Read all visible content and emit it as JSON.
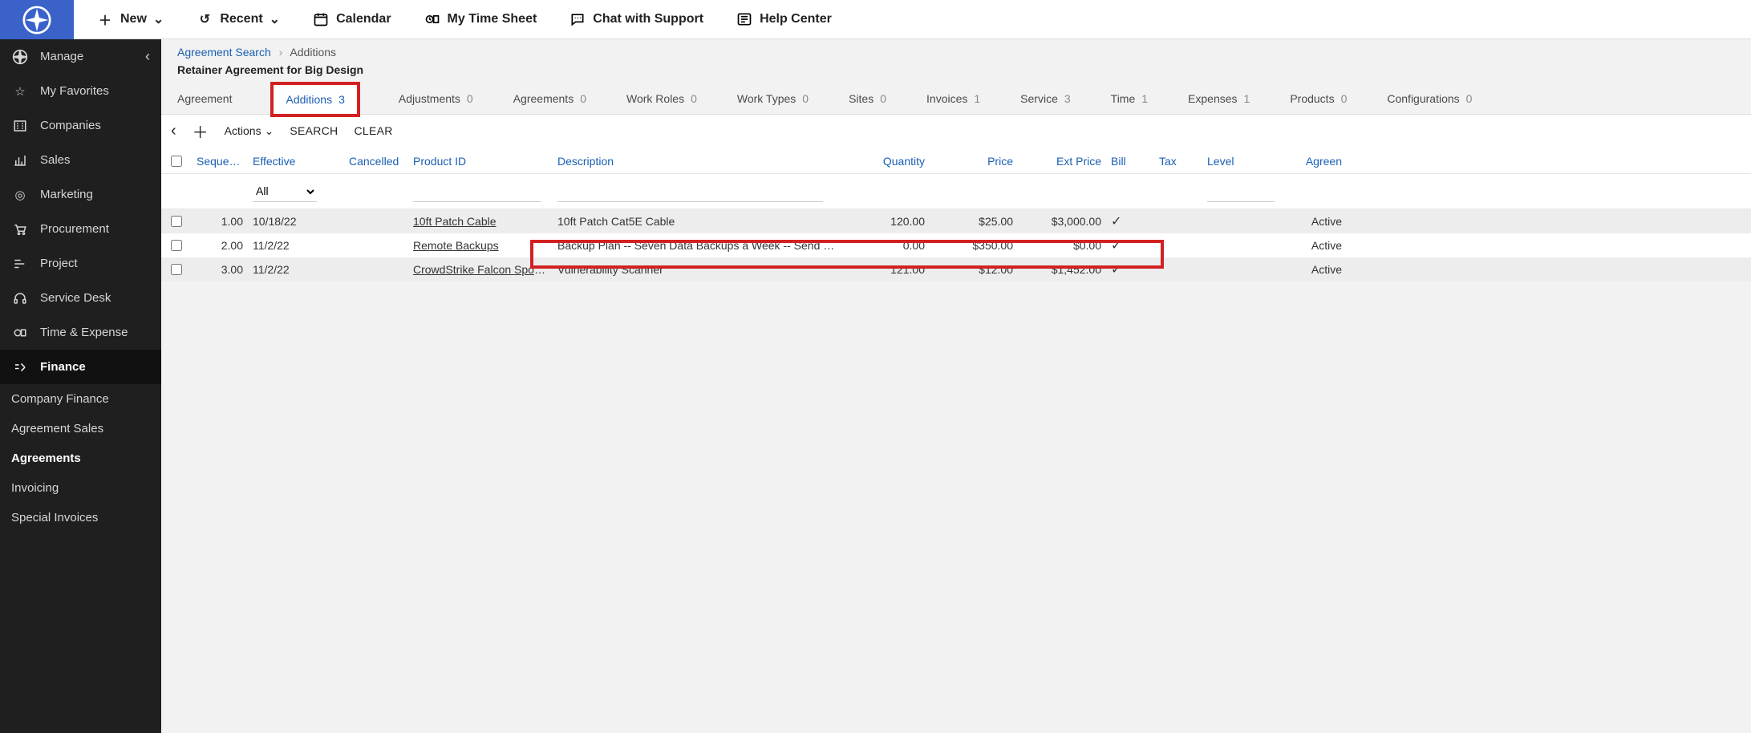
{
  "sidebar": {
    "manage": "Manage",
    "items": [
      {
        "label": "My Favorites"
      },
      {
        "label": "Companies"
      },
      {
        "label": "Sales"
      },
      {
        "label": "Marketing"
      },
      {
        "label": "Procurement"
      },
      {
        "label": "Project"
      },
      {
        "label": "Service Desk"
      },
      {
        "label": "Time & Expense"
      },
      {
        "label": "Finance"
      }
    ],
    "sub": [
      {
        "label": "Company Finance"
      },
      {
        "label": "Agreement Sales"
      },
      {
        "label": "Agreements",
        "active": true
      },
      {
        "label": "Invoicing"
      },
      {
        "label": "Special Invoices"
      }
    ]
  },
  "topbar": {
    "new": "New",
    "recent": "Recent",
    "calendar": "Calendar",
    "timesheet": "My Time Sheet",
    "chat": "Chat with Support",
    "help": "Help Center"
  },
  "crumb": {
    "root": "Agreement Search",
    "current": "Additions"
  },
  "page_title": "Retainer Agreement for Big Design",
  "tabs": [
    {
      "label": "Agreement",
      "count": ""
    },
    {
      "label": "Additions",
      "count": "3",
      "sel": true
    },
    {
      "label": "Adjustments",
      "count": "0"
    },
    {
      "label": "Agreements",
      "count": "0"
    },
    {
      "label": "Work Roles",
      "count": "0"
    },
    {
      "label": "Work Types",
      "count": "0"
    },
    {
      "label": "Sites",
      "count": "0"
    },
    {
      "label": "Invoices",
      "count": "1"
    },
    {
      "label": "Service",
      "count": "3"
    },
    {
      "label": "Time",
      "count": "1"
    },
    {
      "label": "Expenses",
      "count": "1"
    },
    {
      "label": "Products",
      "count": "0"
    },
    {
      "label": "Configurations",
      "count": "0"
    }
  ],
  "toolbar": {
    "actions": "Actions",
    "search": "SEARCH",
    "clear": "CLEAR"
  },
  "columns": {
    "sequence": "Sequence",
    "effective": "Effective",
    "cancelled": "Cancelled",
    "product": "Product ID",
    "description": "Description",
    "quantity": "Quantity",
    "price": "Price",
    "ext": "Ext Price",
    "bill": "Bill",
    "tax": "Tax",
    "level": "Level",
    "agreen": "Agreen"
  },
  "filter": {
    "all": "All"
  },
  "rows": [
    {
      "seq": "1.00",
      "eff": "10/18/22",
      "prod": "10ft Patch Cable",
      "desc": "10ft Patch Cat5E Cable",
      "qty": "120.00",
      "price": "$25.00",
      "ext": "$3,000.00",
      "status": "Active"
    },
    {
      "seq": "2.00",
      "eff": "11/2/22",
      "prod": "Remote Backups",
      "desc": "Backup Plan -- Seven Data Backups a Week -- Send averag...",
      "qty": "0.00",
      "price": "$350.00",
      "ext": "$0.00",
      "status": "Active"
    },
    {
      "seq": "3.00",
      "eff": "11/2/22",
      "prod": "CrowdStrike Falcon Spotlight",
      "desc": "Vulnerability Scanner",
      "qty": "121.00",
      "price": "$12.00",
      "ext": "$1,452.00",
      "status": "Active"
    }
  ]
}
